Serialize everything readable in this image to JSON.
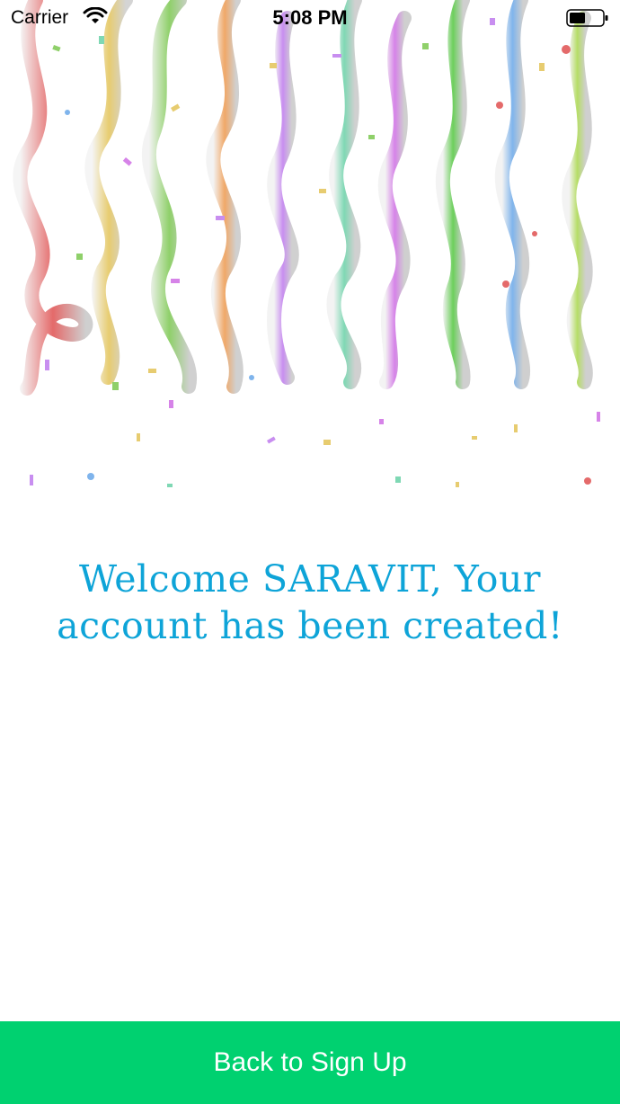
{
  "status_bar": {
    "carrier": "Carrier",
    "time": "5:08 PM",
    "wifi_icon": "wifi-icon",
    "battery_icon": "battery-icon"
  },
  "welcome": {
    "line1": "Welcome SARAVIT, Your",
    "line2": "account has been created!"
  },
  "back_button": {
    "label": "Back to Sign Up"
  },
  "colors": {
    "accent_text": "#0ea4d8",
    "button_bg": "#00d170",
    "button_text": "#ffffff"
  },
  "decoration": {
    "icon": "confetti-streamers-image"
  }
}
